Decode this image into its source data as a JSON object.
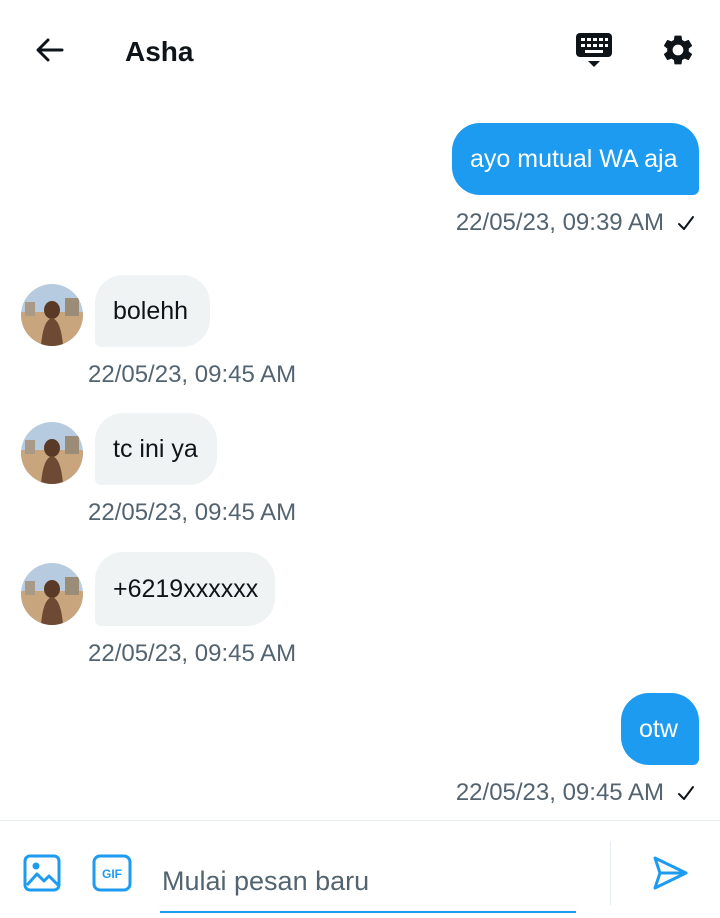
{
  "header": {
    "title": "Asha"
  },
  "messages": [
    {
      "direction": "out",
      "text": "ayo mutual WA aja",
      "timestamp": "22/05/23, 09:39 AM",
      "status": "sent"
    },
    {
      "direction": "in",
      "text": "bolehh",
      "timestamp": "22/05/23, 09:45 AM"
    },
    {
      "direction": "in",
      "text": "tc ini ya",
      "timestamp": "22/05/23, 09:45 AM"
    },
    {
      "direction": "in",
      "text": "+6219xxxxxx",
      "timestamp": "22/05/23, 09:45 AM"
    },
    {
      "direction": "out",
      "text": "otw",
      "timestamp": "22/05/23, 09:45 AM",
      "status": "sent"
    }
  ],
  "composer": {
    "placeholder": "Mulai pesan baru",
    "value": "",
    "gif_label": "GIF"
  },
  "icons": {
    "back": "back-arrow-icon",
    "keyboard": "keyboard-icon",
    "settings": "gear-icon",
    "media": "image-icon",
    "gif": "gif-icon",
    "send": "send-icon",
    "check": "check-icon"
  },
  "colors": {
    "accent": "#1d9bf0",
    "incoming_bubble": "#eff3f4",
    "secondary_text": "#536471",
    "primary_text": "#0f1419"
  }
}
